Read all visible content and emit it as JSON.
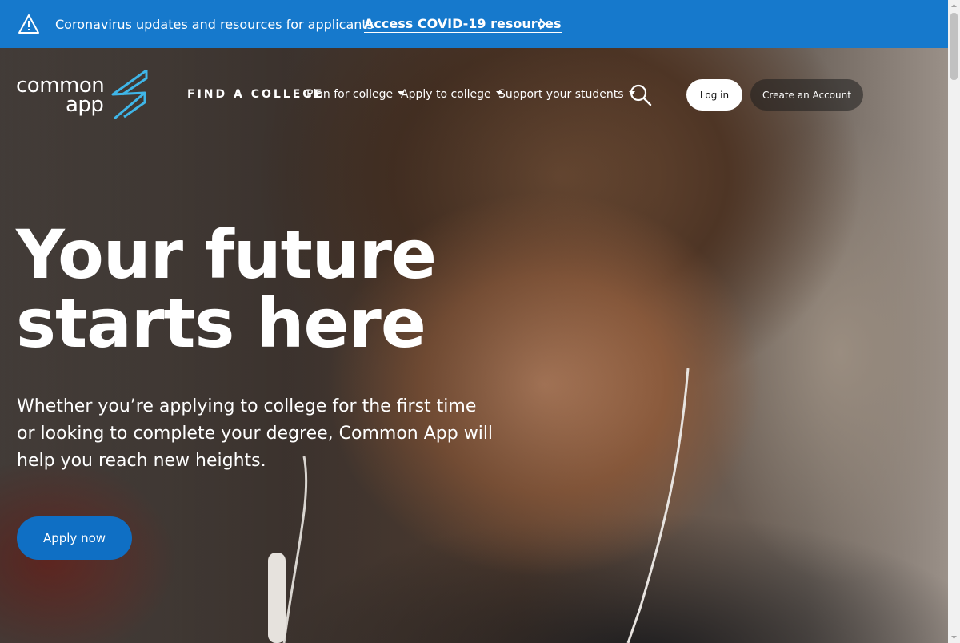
{
  "alert": {
    "text": "Coronavirus updates and resources for applicants",
    "link": "Access COVID-19 resources",
    "icon": "warning-triangle-icon",
    "background": "#1679cc"
  },
  "header": {
    "logo_line1": "common",
    "logo_line2": "app",
    "nav": {
      "find_college": "FIND A COLLEGE",
      "plan": "Plan for college",
      "apply": "Apply to college",
      "support": "Support your students"
    },
    "login": "Log in",
    "create_account": "Create an Account"
  },
  "hero": {
    "headline": "Your future starts here",
    "subcopy": "Whether you’re applying to college for the first time or looking to complete your degree, Common App will help you reach new heights.",
    "cta": "Apply now",
    "cta_color": "#0f6fc4"
  },
  "colors": {
    "brand_blue": "#1679cc",
    "logo_accent": "#3fb6e8"
  }
}
